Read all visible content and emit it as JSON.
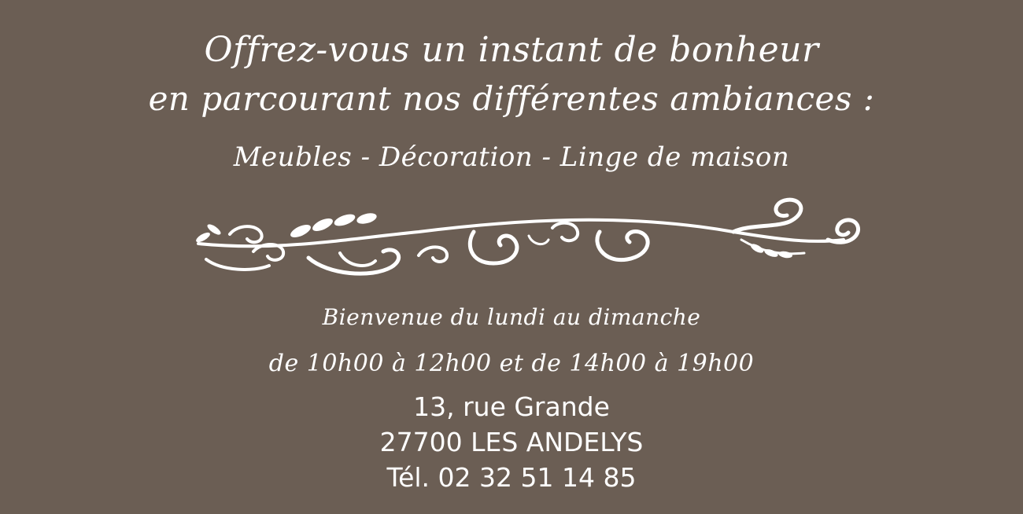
{
  "intro": {
    "line1": "Offrez-vous un instant de bonheur",
    "line2": "en parcourant nos différentes ambiances :",
    "categories": "Meubles - Décoration - Linge de maison"
  },
  "hours": {
    "welcome": "Bienvenue du lundi au dimanche",
    "times": "de  10h00 à 12h00 et de 14h00 à 19h00"
  },
  "address": {
    "street": "13, rue Grande",
    "city": "27700 LES ANDELYS",
    "phone": "Tél. 02 32 51 14 85"
  },
  "colors": {
    "background": "#6b5e54",
    "text": "#ffffff"
  },
  "ornament": "flourish-scroll"
}
